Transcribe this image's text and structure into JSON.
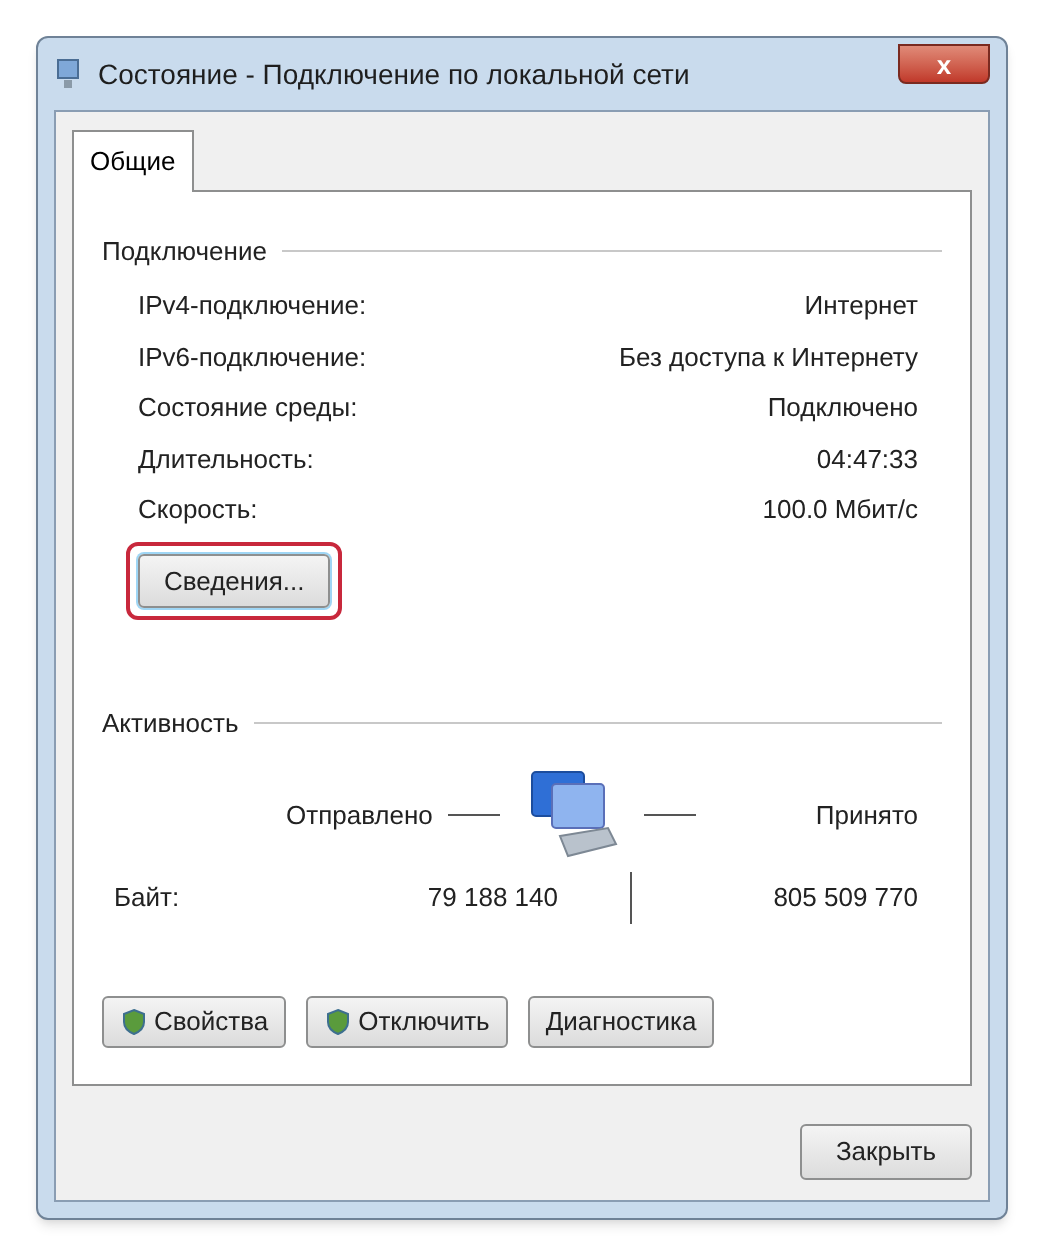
{
  "window": {
    "title": "Состояние - Подключение по локальной сети",
    "close": "x"
  },
  "tabs": [
    {
      "label": "Общие",
      "selected": true
    }
  ],
  "connection": {
    "heading": "Подключение",
    "rows": [
      {
        "label": "IPv4-подключение:",
        "value": "Интернет"
      },
      {
        "label": "IPv6-подключение:",
        "value": "Без доступа к Интернету"
      },
      {
        "label": "Состояние среды:",
        "value": "Подключено"
      },
      {
        "label": "Длительность:",
        "value": "04:47:33"
      },
      {
        "label": "Скорость:",
        "value": "100.0 Мбит/с"
      }
    ],
    "details_button": {
      "label": "Сведения...",
      "highlighted": true
    }
  },
  "activity": {
    "heading": "Активность",
    "sent_label": "Отправлено",
    "received_label": "Принято",
    "bytes_label": "Байт:",
    "sent": "79 188 140",
    "received": "805 509 770"
  },
  "buttons": [
    {
      "label": "Свойства",
      "shield": true
    },
    {
      "label": "Отключить",
      "shield": true
    },
    {
      "label": "Диагностика",
      "shield": false
    }
  ],
  "footer_button": "Закрыть"
}
